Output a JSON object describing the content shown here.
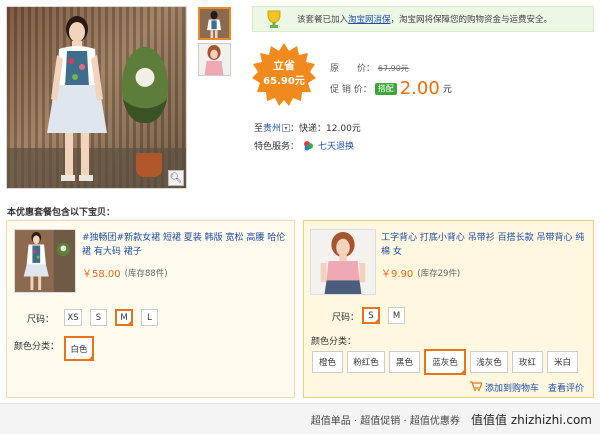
{
  "notice": {
    "prefix": "该套餐已加入",
    "link": "淘宝网消保",
    "suffix": "，淘宝网将保障您的购物资金与运费安全。"
  },
  "badge": {
    "line1": "立省",
    "line2": "65.90元"
  },
  "price": {
    "original_label": "原　　价：",
    "original_value": "67.90元",
    "promo_label": "促 销 价：",
    "promo_tag": "搭配",
    "promo_value": "2.00",
    "promo_unit": "元"
  },
  "shipping": {
    "label": "至",
    "region": "贵州",
    "express": "：快递：12.00元"
  },
  "service": {
    "label": "特色服务：",
    "text": "七天退换"
  },
  "section_title": "本优惠套餐包含以下宝贝：",
  "products": [
    {
      "title": "#独畅团#新款女裙 短裙 夏装 韩版 宽松 高腰 哈伦裙 有大码 裙子",
      "price": "￥58.00",
      "stock": "(库存88件)",
      "size_label": "尺码：",
      "sizes": [
        "XS",
        "S",
        "M",
        "L"
      ],
      "selected_size": "M",
      "color_label": "颜色分类：",
      "colors": [
        "白色"
      ],
      "selected_color": "白色"
    },
    {
      "title": "工字背心 打底小背心 吊带衫 百搭长款 吊带背心 纯棉 女",
      "price": "￥9.90",
      "stock": "(库存29件)",
      "size_label": "尺码：",
      "sizes": [
        "S",
        "M"
      ],
      "selected_size": "S",
      "color_label": "颜色分类：",
      "colors": [
        "橙色",
        "粉红色",
        "黑色",
        "蓝灰色",
        "浅灰色",
        "玫红",
        "米白"
      ],
      "selected_color": "蓝灰色",
      "add_cart": "添加到购物车",
      "view_review": "查看评价"
    }
  ],
  "footer": {
    "text": "超值单品 · 超值促销 · 超值优惠券",
    "brand": "值值值 zhizhizhi.com"
  },
  "colors": {
    "accent": "#f06a0f",
    "link": "#1f4fa8",
    "selection": "#e8741a",
    "badge": "#f08a1c"
  }
}
